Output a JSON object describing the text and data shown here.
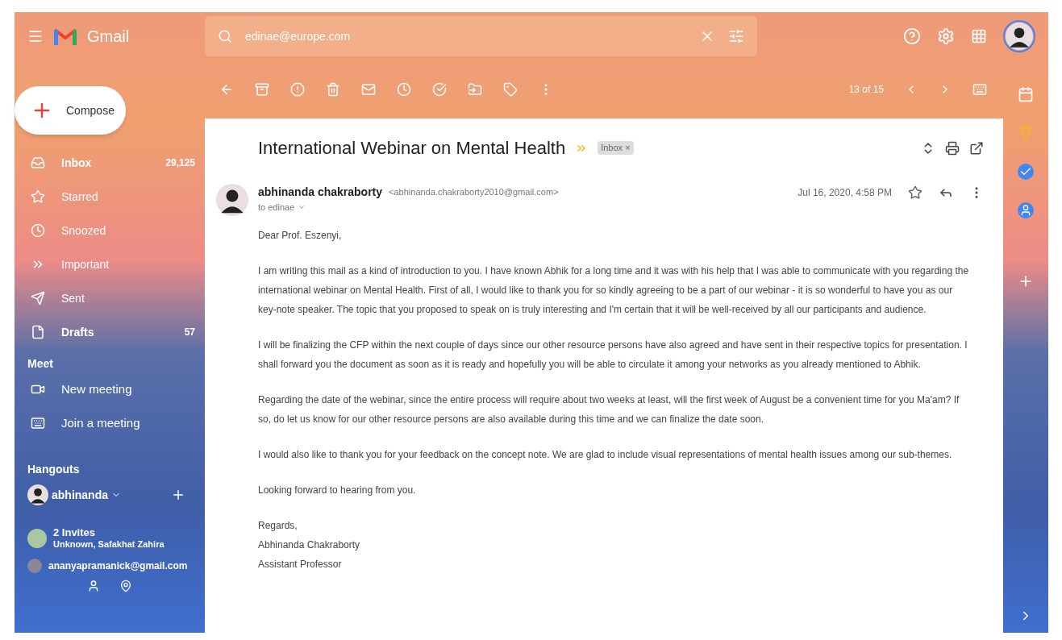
{
  "app": {
    "name": "Gmail"
  },
  "search": {
    "value": "edinae@europe.com"
  },
  "compose": {
    "label": "Compose"
  },
  "nav": [
    {
      "label": "Inbox",
      "count": "29,125",
      "unread": true,
      "kind": "inbox"
    },
    {
      "label": "Starred",
      "unread": false,
      "kind": "star"
    },
    {
      "label": "Snoozed",
      "unread": false,
      "kind": "clock"
    },
    {
      "label": "Important",
      "unread": false,
      "kind": "important"
    },
    {
      "label": "Sent",
      "unread": false,
      "kind": "send"
    },
    {
      "label": "Drafts",
      "count": "57",
      "unread": true,
      "kind": "file"
    }
  ],
  "meet": {
    "heading": "Meet",
    "items": [
      {
        "label": "New meeting",
        "kind": "video"
      },
      {
        "label": "Join a meeting",
        "kind": "keyboard"
      }
    ]
  },
  "hangouts": {
    "heading": "Hangouts",
    "user": "abhinanda",
    "invites_title": "2 Invites",
    "invites_names": "Unknown, Safakhat Zahira",
    "contact": "ananyapramanick@gmail.com"
  },
  "toolbar": {
    "pagination": "13 of 15"
  },
  "email": {
    "subject": "International Webinar on Mental Health",
    "label": "Inbox",
    "label_close": "×",
    "sender_name": "abhinanda chakraborty",
    "sender_email": "<abhinanda.chakraborty2010@gmail.com>",
    "recipient": "to edinae",
    "date": "Jul 16, 2020, 4:58 PM",
    "starred": false,
    "body": [
      "Dear Prof. Eszenyi,",
      "I am writing this mail as a kind of introduction to you. I have known Abhik for a long time and it was with his help that I was able to communicate with you regarding the international webinar on Mental Health. First of all, I would like to thank you for so kindly agreeing to be a part of our webinar - it is so wonderful to have you as our key-note speaker. The topic that you proposed to speak on is truly interesting and I'm certain that it will be well-received by all our participants and audience.",
      "I will be finalizing the CFP within the next couple of days since our other resource persons have also agreed and have sent in their respective topics for presentation. I shall forward you the document as soon as it is ready and hopefully you will be able to circulate it among your networks as you already mentioned to Abhik.",
      "Regarding the date of the webinar, since the entire process will require about two weeks at least, will the first week of August be a convenient time for you Ma'am? If so, do let us know for our other resource persons are also available during this time and we can finalize the date soon.",
      "I would also like to thank you for your feedback on the concept note. We are glad to include visual representations of mental health issues among our sub-themes.",
      "Looking forward to hearing from you."
    ],
    "signature": [
      "Regards,",
      "Abhinanda Chakraborty",
      "Assistant Professor"
    ]
  }
}
